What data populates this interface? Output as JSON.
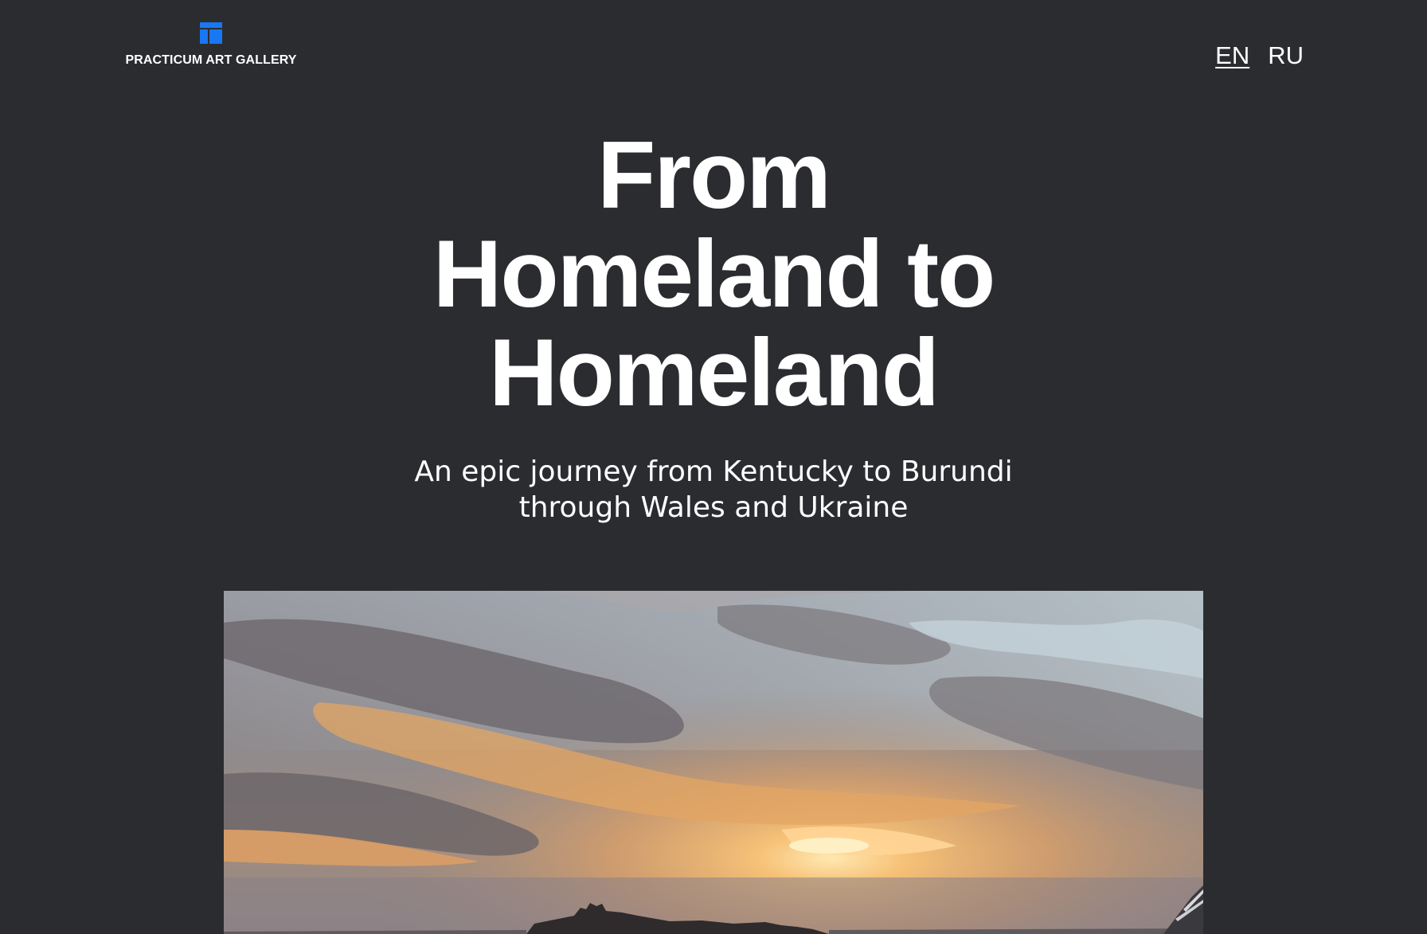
{
  "header": {
    "logo_text": "PRACTICUM ART GALLERY",
    "logo_icon": "gallery-logo-icon",
    "languages": [
      {
        "label": "EN",
        "active": true
      },
      {
        "label": "RU",
        "active": false
      }
    ]
  },
  "hero": {
    "title_lines": [
      "From",
      "Homeland to",
      "Homeland"
    ],
    "subtitle_lines": [
      "An epic journey from Kentucky to Burundi",
      "through Wales and Ukraine"
    ]
  },
  "cover_image": {
    "description_icon": "sunset-landscape-photo"
  },
  "colors": {
    "background": "#2b2c30",
    "text": "#ffffff",
    "brand_accent": "#1a73e8"
  }
}
